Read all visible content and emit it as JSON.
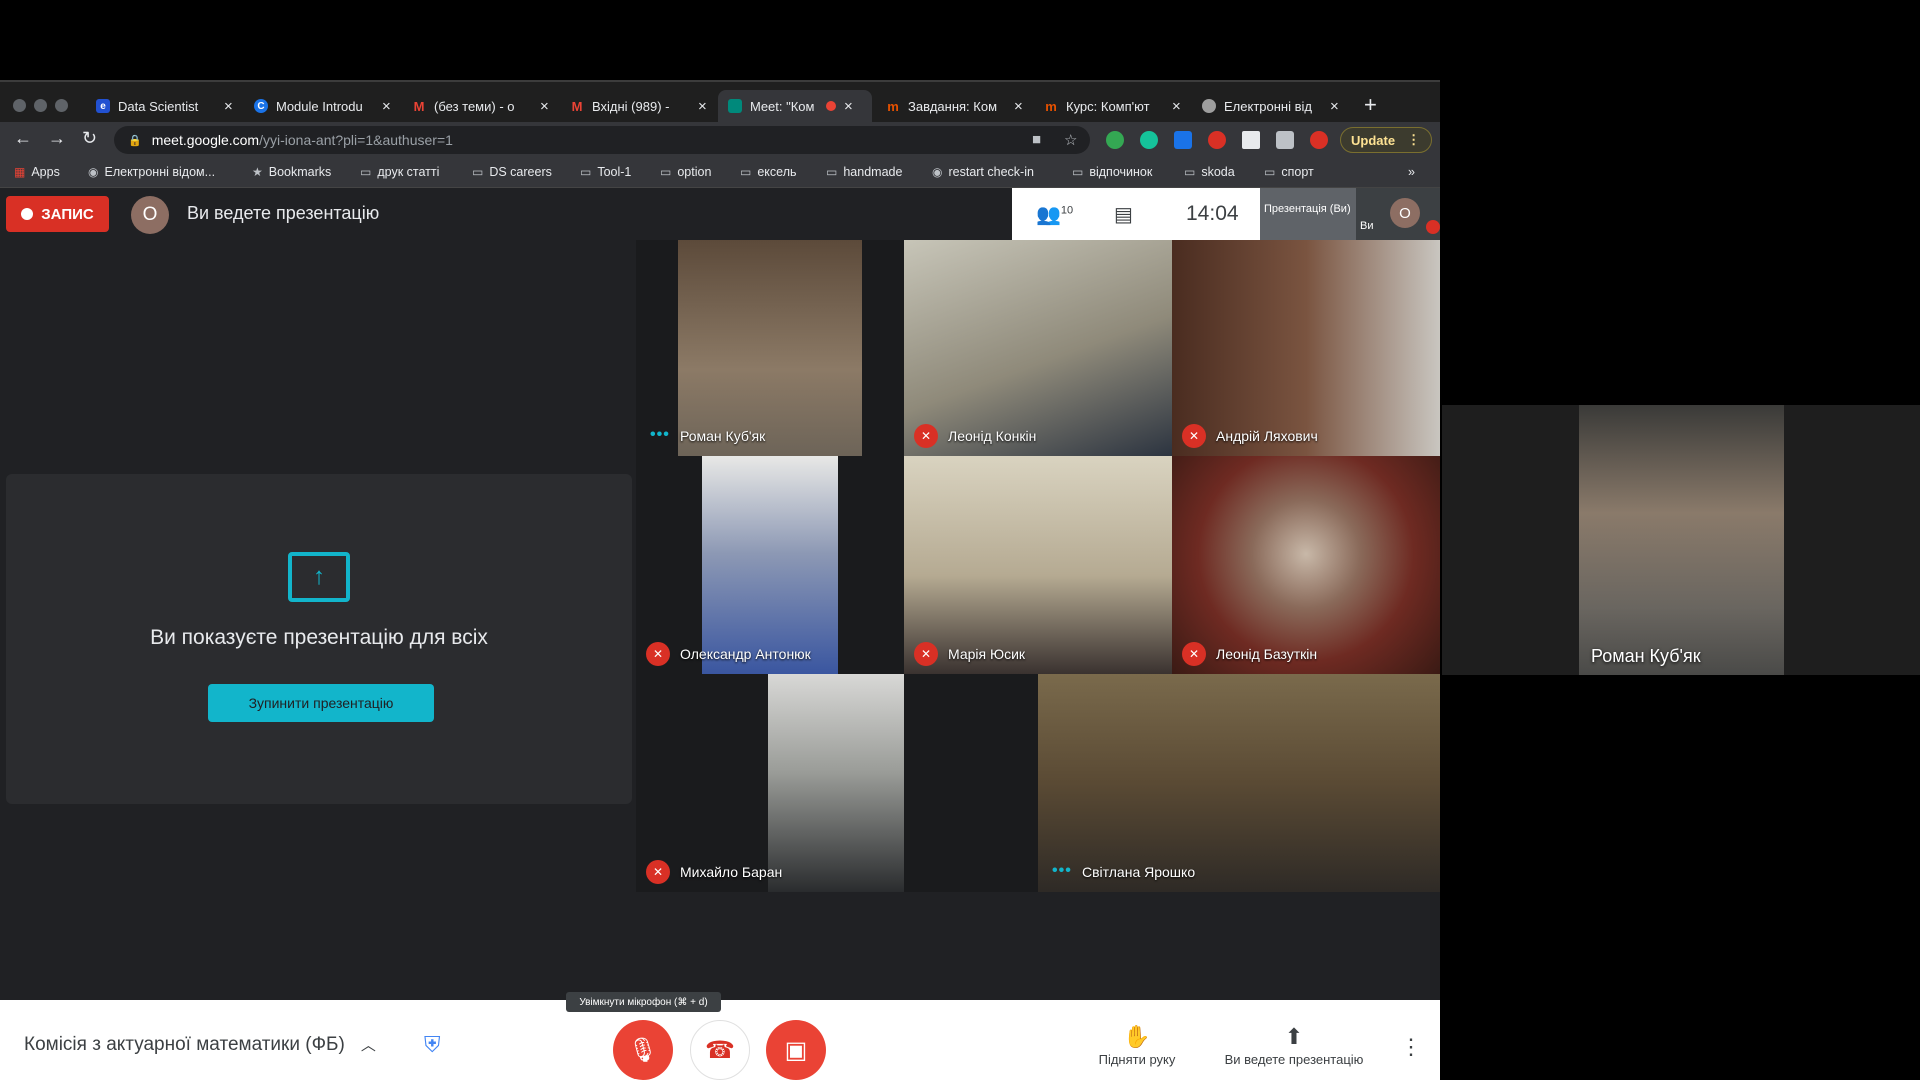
{
  "tabs": [
    {
      "title": "Data Scientist",
      "icon": "e",
      "icon_color": "#2251d1"
    },
    {
      "title": "Module Introdu",
      "icon": "C",
      "icon_color": "#1a73e8"
    },
    {
      "title": "(без теми) - o",
      "icon": "M",
      "icon_color": "#ea4335"
    },
    {
      "title": "Вхідні (989) -",
      "icon": "M",
      "icon_color": "#ea4335"
    },
    {
      "title": "Meet: \"Ком",
      "icon": "",
      "icon_color": "#00897b"
    },
    {
      "title": "Завдання: Ком",
      "icon": "m",
      "icon_color": "#e65100"
    },
    {
      "title": "Курс: Комп'ют",
      "icon": "m",
      "icon_color": "#e65100"
    },
    {
      "title": "Електронні від",
      "icon": "",
      "icon_color": "#9e9e9e"
    }
  ],
  "address": {
    "host": "meet.google.com",
    "path": "/yyi-iona-ant?pli=1&authuser=1"
  },
  "update_label": "Update",
  "bookmarks": [
    "Apps",
    "Електронні відом...",
    "Bookmarks",
    "друк статті",
    "DS careers",
    "Tool-1",
    "option",
    "ексель",
    "handmade",
    "restart check-in",
    "відпочинок",
    "skoda",
    "спорт"
  ],
  "record_label": "ЗАПИС",
  "self_initial": "О",
  "presenting_status": "Ви ведете презентацію",
  "top_panel": {
    "people_count": "10",
    "clock": "14:04",
    "presentation_thumb": "Презентація (Ви)",
    "self_label": "Ви"
  },
  "presentation_box": {
    "message": "Ви показуєте презентацію для всіх",
    "stop_label": "Зупинити презентацію"
  },
  "participants": [
    {
      "name": "Роман Куб'як",
      "muted": false,
      "video_color": "#7d6a55"
    },
    {
      "name": "Леонід Конкін",
      "muted": true,
      "video_color": "#9a9583"
    },
    {
      "name": "Андрій Ляхович",
      "muted": true,
      "video_color": "#6e4a37"
    },
    {
      "name": "Олександр Антонюк",
      "muted": true,
      "video_color": "#5a6d8f"
    },
    {
      "name": "Марія Юсик",
      "muted": true,
      "video_color": "#b4aa95"
    },
    {
      "name": "Леонід Базуткін",
      "muted": true,
      "video_color": "#7a3a2e"
    },
    {
      "name": "Михайло Баран",
      "muted": true,
      "video_color": "#a8a9a6"
    },
    {
      "name": "Світлана Ярошко",
      "muted": false,
      "video_color": "#6b5a3c"
    }
  ],
  "meeting_title": "Комісія з актуарної математики (ФБ)",
  "mic_tooltip": "Увімкнути мікрофон (⌘ + d)",
  "raise_hand_label": "Підняти руку",
  "presenting_action_label": "Ви ведете презентацію",
  "side_tile_name": "Роман Куб'як",
  "colors": {
    "accent": "#12b5cb",
    "danger": "#ea4335"
  }
}
